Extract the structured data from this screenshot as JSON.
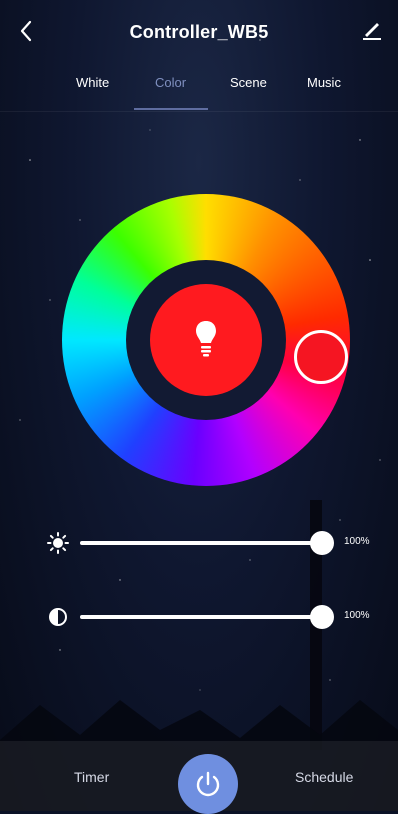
{
  "header": {
    "title": "Controller_WB5"
  },
  "tabs": [
    {
      "label": "White"
    },
    {
      "label": "Color"
    },
    {
      "label": "Scene"
    },
    {
      "label": "Music"
    }
  ],
  "active_tab": "Color",
  "color_picker": {
    "selected_color": "#ff1a1f"
  },
  "sliders": {
    "brightness": {
      "value_label": "100%",
      "value": 1.0
    },
    "saturation": {
      "value_label": "100%",
      "value": 1.0
    }
  },
  "bottom_bar": {
    "timer_label": "Timer",
    "schedule_label": "Schedule"
  },
  "colors": {
    "accent": "#6f8fe0",
    "active_tab": "#7f8fbf"
  },
  "icons": {
    "back": "chevron-left-icon",
    "edit": "pencil-icon",
    "bulb": "lightbulb-icon",
    "brightness": "sun-icon",
    "saturation": "contrast-icon",
    "power": "power-icon"
  }
}
